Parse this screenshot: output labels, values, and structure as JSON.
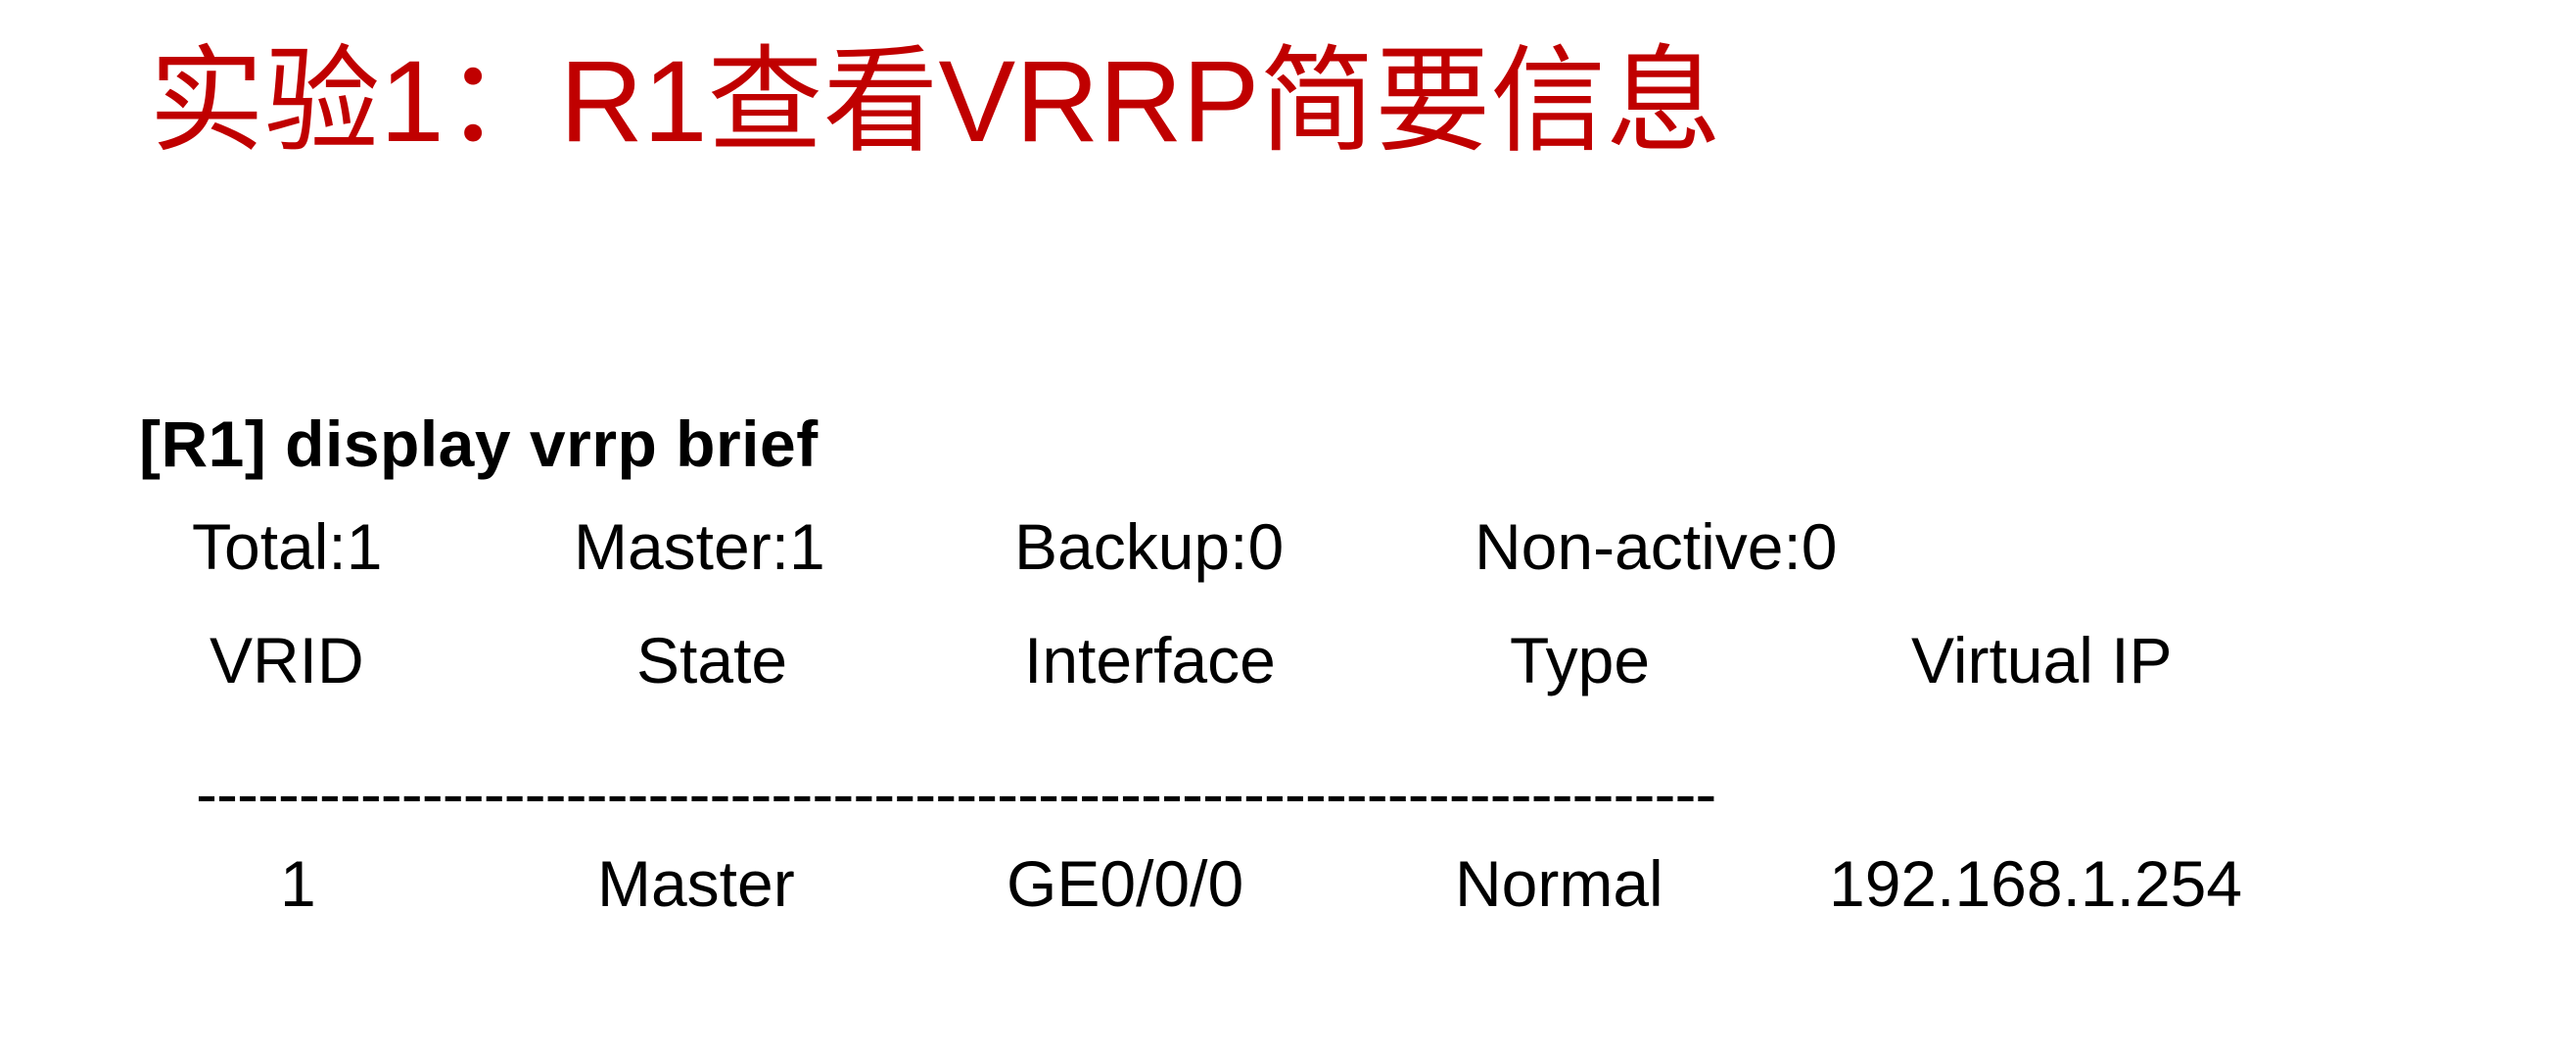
{
  "slide": {
    "title": "实验1：R1查看VRRP简要信息",
    "title_color": "#C00000",
    "background_color": "#FFFFFF",
    "body_text_color": "#000000"
  },
  "console": {
    "prompt_line": "[R1] display vrrp brief",
    "summary": {
      "total_label": "Total:1",
      "master_label": "Master:1",
      "backup_label": "Backup:0",
      "non_active_label": "Non-active:0"
    },
    "table": {
      "headers": [
        "VRID",
        "State",
        "Interface",
        "Type",
        "Virtual IP"
      ],
      "divider": "--------------------------------------------------------------------------",
      "rows": [
        {
          "vrid": "1",
          "state": "Master",
          "interface": "GE0/0/0",
          "type": "Normal",
          "virtual_ip": "192.168.1.254"
        }
      ]
    }
  }
}
